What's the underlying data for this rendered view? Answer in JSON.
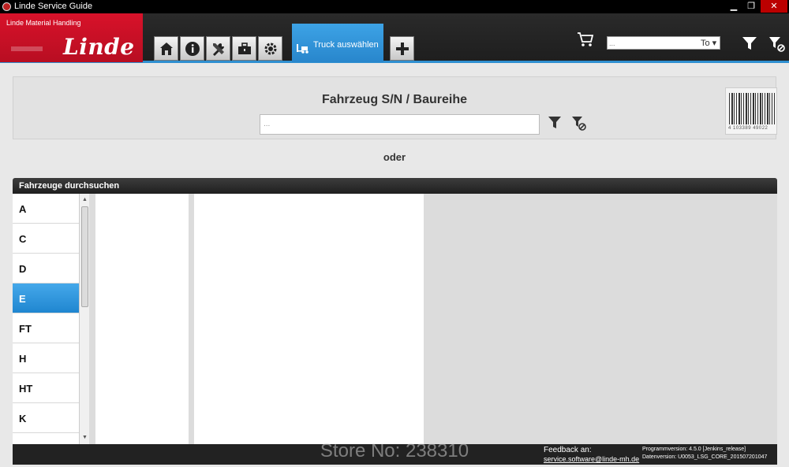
{
  "window": {
    "title": "Linde Service Guide",
    "minimize": "▁",
    "maximize": "❐",
    "close": "✕"
  },
  "brand": {
    "subtitle": "Linde Material Handling",
    "logo": "Linde"
  },
  "nav": {
    "buttons": [
      "home-icon",
      "info-icon",
      "tools-icon",
      "toolbox-icon",
      "settings-icon"
    ],
    "active_tab": "Truck auswählen",
    "add_label": "+"
  },
  "header_search": {
    "placeholder": "...",
    "select_value": "To"
  },
  "serial": {
    "title": "Fahrzeug S/N / Baureihe",
    "placeholder": "...",
    "barcode_number": "4 103389 49022"
  },
  "oder": "oder",
  "browse": {
    "title": "Fahrzeuge durchsuchen",
    "items": [
      "A",
      "C",
      "D",
      "E",
      "FT",
      "H",
      "HT",
      "K"
    ],
    "selected": "E"
  },
  "footer": {
    "watermark": "Store No: 238310",
    "feedback_label": "Feedback an:",
    "feedback_email": "service.software@linde-mh.de",
    "program_version": "Programmversion: 4.5.0 [Jenkins_release]",
    "data_version": "Datenversion: U0053_LSG_CORE_201507201047"
  },
  "colors": {
    "brand_red": "#d8122a",
    "accent_blue": "#2f8fd0"
  }
}
